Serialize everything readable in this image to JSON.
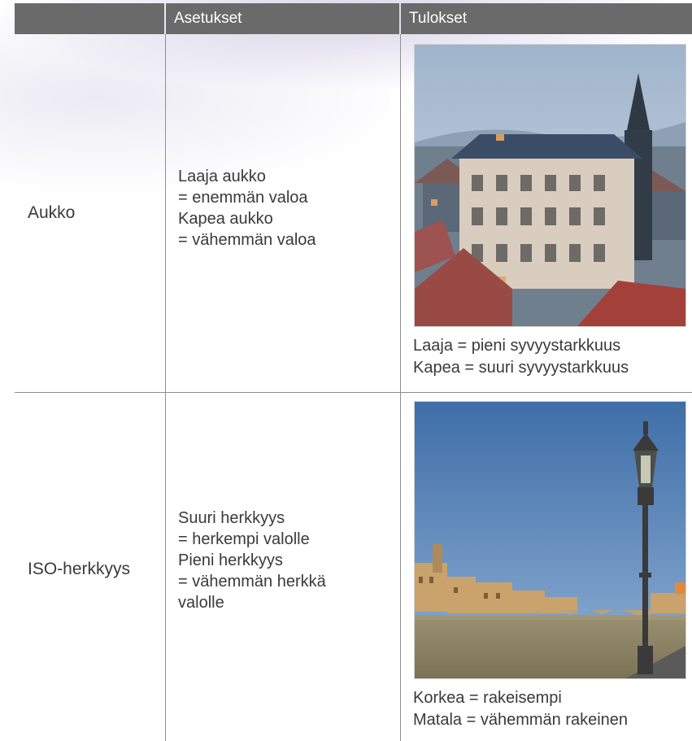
{
  "header": {
    "col_settings": "Asetukset",
    "col_results": "Tulokset"
  },
  "rows": [
    {
      "label": "Aukko",
      "settings": [
        "Laaja aukko",
        "= enemmän valoa",
        "Kapea aukko",
        "= vähemmän valoa"
      ],
      "results": [
        "Laaja = pieni syvyystarkkuus",
        "Kapea = suuri syvyystarkkuus"
      ],
      "image_icon": "city-rooftops-photo"
    },
    {
      "label": "ISO-herkkyys",
      "settings": [
        "Suuri herkkyys",
        "= herkempi valolle",
        "Pieni herkkyys",
        "= vähemmän herkkä",
        "valolle"
      ],
      "results": [
        "Korkea = rakeisempi",
        "Matala = vähemmän rakeinen"
      ],
      "image_icon": "riverside-lamppost-photo"
    }
  ],
  "colors": {
    "header_bg": "#6a6a6a",
    "header_text": "#ffffff",
    "grid_line": "#8f8f8f",
    "body_text": "#3a3a3a"
  }
}
